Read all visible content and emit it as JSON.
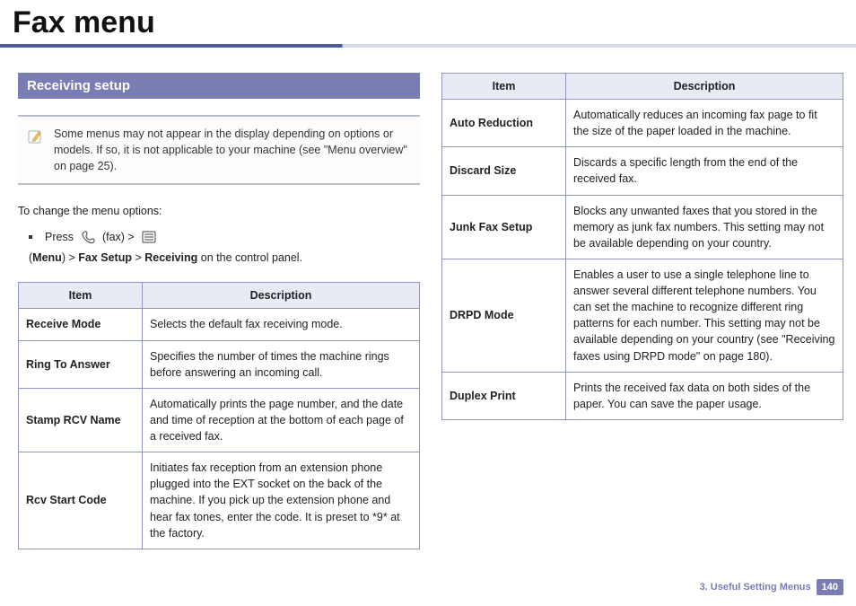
{
  "title": "Fax menu",
  "section_header": "Receiving setup",
  "note_text": "Some menus may not appear in the display depending on options or models. If so, it is not applicable to your machine (see \"Menu overview\" on page 25).",
  "instruction": "To change the menu options:",
  "press_label": "Press",
  "fax_label": " (fax) > ",
  "menu_label": "Menu",
  "fax_setup_label": "Fax Setup",
  "receiving_label": "Receiving",
  "control_panel_tail": " on the control panel.",
  "table_headers": {
    "item": "Item",
    "desc": "Description"
  },
  "left_rows": [
    {
      "item": "Receive Mode",
      "desc": "Selects the default fax receiving mode."
    },
    {
      "item": "Ring To Answer",
      "desc": "Specifies the number of times the machine rings before answering an incoming call."
    },
    {
      "item": "Stamp RCV Name",
      "desc": "Automatically prints the page number, and the date and time of reception at the bottom of each page of a received fax."
    },
    {
      "item": "Rcv Start Code",
      "desc": "Initiates fax reception from an extension phone plugged into the EXT socket on the back of the machine. If you pick up the extension phone and hear fax tones, enter the code. It is preset to *9* at the factory."
    }
  ],
  "right_rows": [
    {
      "item": "Auto Reduction",
      "desc": "Automatically reduces an incoming fax page to fit the size of the paper loaded in the machine."
    },
    {
      "item": "Discard Size",
      "desc": "Discards a specific length from the end of the received fax."
    },
    {
      "item": "Junk Fax Setup",
      "desc": "Blocks any unwanted faxes that you stored in the memory as junk fax numbers. This setting may not be available depending on your country."
    },
    {
      "item": "DRPD Mode",
      "desc": " Enables a user to use a single telephone line to answer several different telephone numbers. You can set the machine to recognize different ring patterns for each number. This setting may not be available depending on your country (see \"Receiving faxes using DRPD mode\" on page 180)."
    },
    {
      "item": "Duplex Print",
      "desc": "Prints the received fax data on both sides of the paper. You can save the paper usage."
    }
  ],
  "footer": {
    "chapter": "3.  Useful Setting Menus",
    "page": "140"
  }
}
